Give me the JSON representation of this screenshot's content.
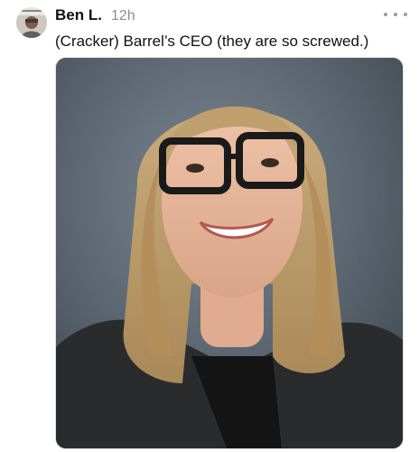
{
  "post": {
    "author": "Ben L.",
    "time": "12h",
    "text": "(Cracker) Barrel’s CEO (they are so screwed.)"
  },
  "icons": {
    "avatar": "avatar-image",
    "more": "more-horizontal-icon"
  },
  "colors": {
    "background": "#ffffff",
    "text": "#111111",
    "muted": "#8e8e93",
    "photo_backdrop": "#5b6670"
  }
}
